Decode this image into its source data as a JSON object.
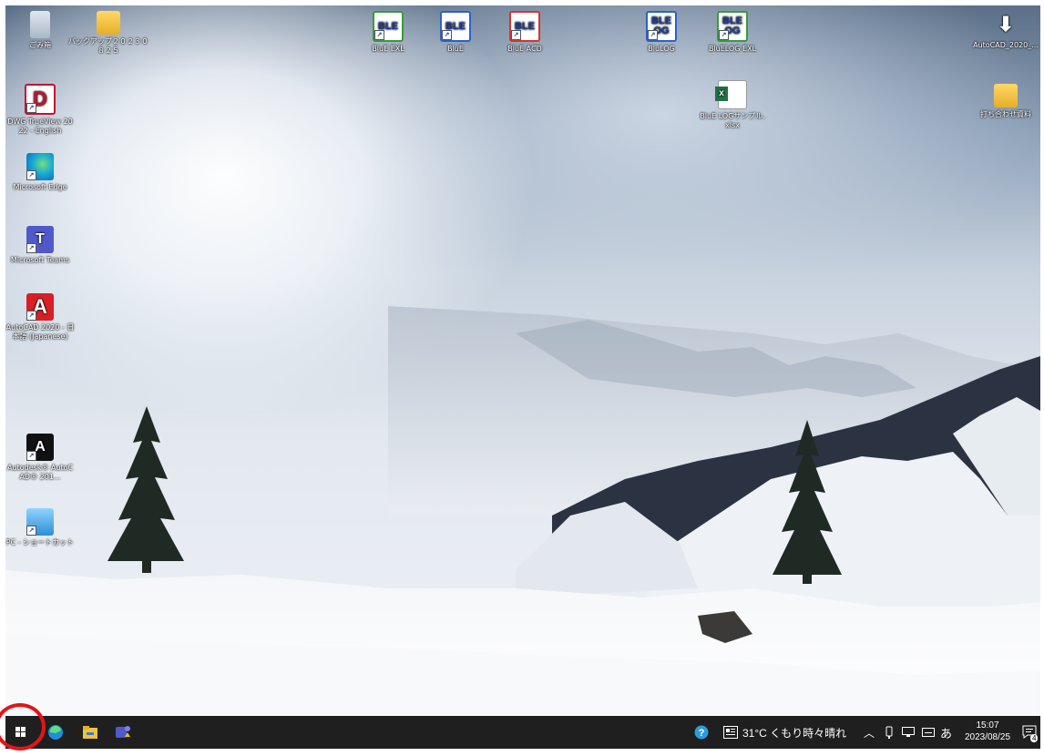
{
  "desktop": {
    "icons_left": [
      {
        "label": "ごみ箱",
        "icon": "recycle-bin-icon"
      },
      {
        "label": "DWG TrueView 2022 - English",
        "icon": "dwg-trueview-icon"
      },
      {
        "label": "Microsoft Edge",
        "icon": "edge-icon"
      },
      {
        "label": "Microsoft Teams",
        "icon": "teams-icon"
      },
      {
        "label": "AutoCAD 2020 - 日本語 (Japanese)",
        "icon": "autocad-icon"
      },
      {
        "label": "Autodesk® AutoCAD® 201...",
        "icon": "autocad-uninstall-icon"
      },
      {
        "label": "PC - ショートカット",
        "icon": "pc-shortcut-icon"
      }
    ],
    "icon_backup_folder": {
      "label": "バックアップ２０２３０８２５",
      "icon": "folder-icon"
    },
    "icons_top": [
      {
        "label": "BluE EXL",
        "glyph": "BLE",
        "icon": "blue-exl-icon"
      },
      {
        "label": "BluE",
        "glyph": "BLE",
        "icon": "blue-icon"
      },
      {
        "label": "BluE ACD",
        "glyph": "BLE",
        "icon": "blue-acd-icon"
      },
      {
        "label": "BluLOG",
        "glyph": "BLE OG",
        "icon": "blulog-icon"
      },
      {
        "label": "BluELOG EXL",
        "glyph": "BLE OG",
        "icon": "bluelog-exl-icon"
      }
    ],
    "icon_xlsx": {
      "label": "BluE LOGサンプル.xlsx",
      "icon": "excel-file-icon"
    },
    "icon_autocad_right": {
      "label": "AutoCAD_2020_...",
      "icon": "autocad-download-icon"
    },
    "icon_meeting_folder": {
      "label": "打ち合わせ資料",
      "icon": "folder-icon"
    }
  },
  "taskbar": {
    "weather": "31°C くもり時々晴れ",
    "ime": "あ",
    "time": "15:07",
    "date": "2023/08/25",
    "notification_count": "4"
  },
  "colors": {
    "taskbar_bg": "#1f1f1f",
    "annotation": "#e3141a",
    "start_accent": "#ffffff"
  }
}
